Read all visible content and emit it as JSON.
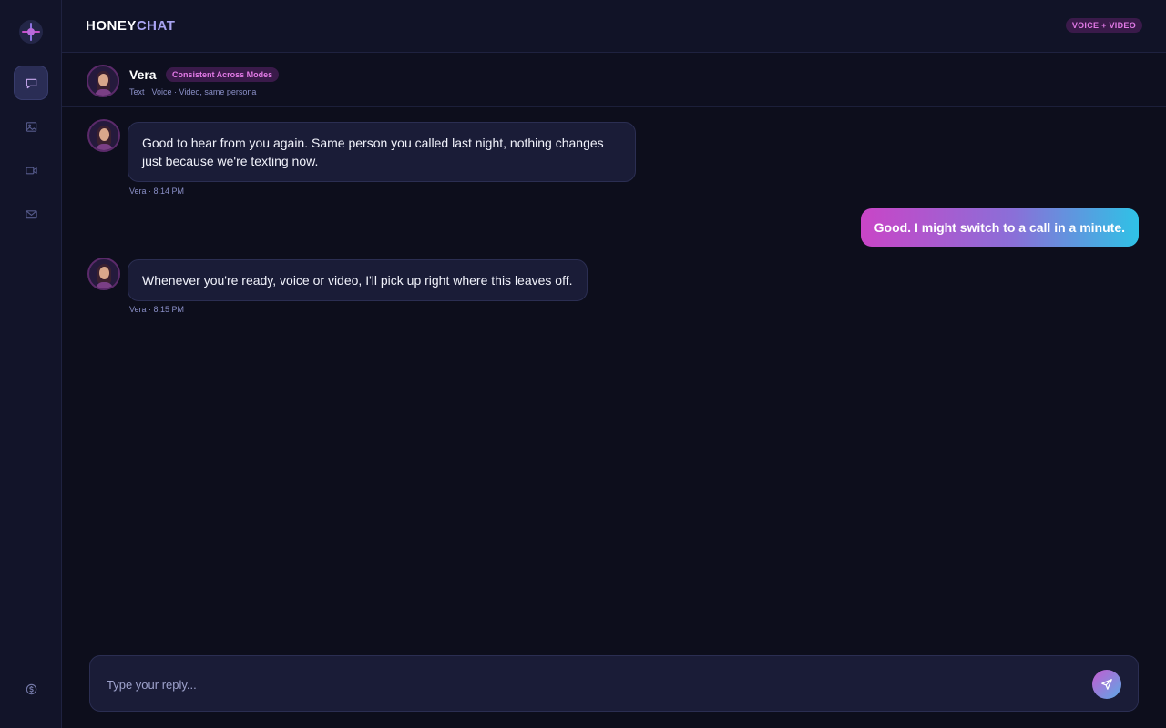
{
  "app": {
    "brand_part1": "HONEY",
    "brand_part2": "CHAT",
    "mode_badge": "VOICE + VIDEO"
  },
  "sidebar": {
    "items": [
      {
        "icon": "chat-icon",
        "active": true
      },
      {
        "icon": "image-icon",
        "active": false
      },
      {
        "icon": "video-icon",
        "active": false
      },
      {
        "icon": "mail-icon",
        "active": false
      }
    ],
    "footer_icon": "coin-icon"
  },
  "contact": {
    "name": "Vera",
    "tag": "Consistent Across Modes",
    "subtitle": "Text · Voice · Video, same persona"
  },
  "messages": [
    {
      "from": "Vera",
      "text": "Good to hear from you again. Same person you called last night, nothing changes just because we're texting now.",
      "meta": "Vera · 8:14 PM"
    },
    {
      "from": "me",
      "text": "Good. I might switch to a call in a minute."
    },
    {
      "from": "Vera",
      "text": "Whenever you're ready, voice or video, I'll pick up right where this leaves off.",
      "meta": "Vera · 8:15 PM"
    }
  ],
  "composer": {
    "placeholder": "Type your reply..."
  },
  "colors": {
    "background": "#0d0e1c",
    "accent_pink": "#c945c7",
    "accent_cyan": "#2fc2e6",
    "badge_text": "#e27ae6"
  }
}
